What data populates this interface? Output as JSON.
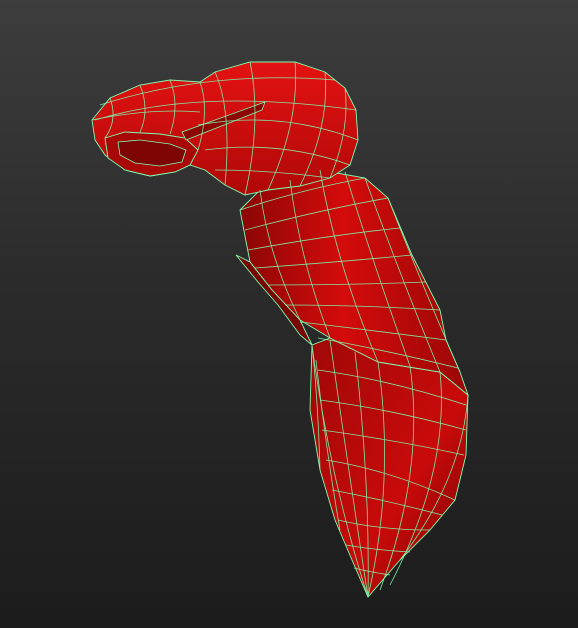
{
  "viewport": {
    "background_top": "#3d3d3d",
    "background_bottom": "#1c1c1c"
  },
  "model": {
    "shape": "bent-limb-mesh",
    "display_mode": "wireframe-on-shaded",
    "fill_color": "#cc0a0a",
    "fill_highlight": "#e01010",
    "fill_shadow": "#8a0606",
    "wire_color": "#7dffb0"
  }
}
